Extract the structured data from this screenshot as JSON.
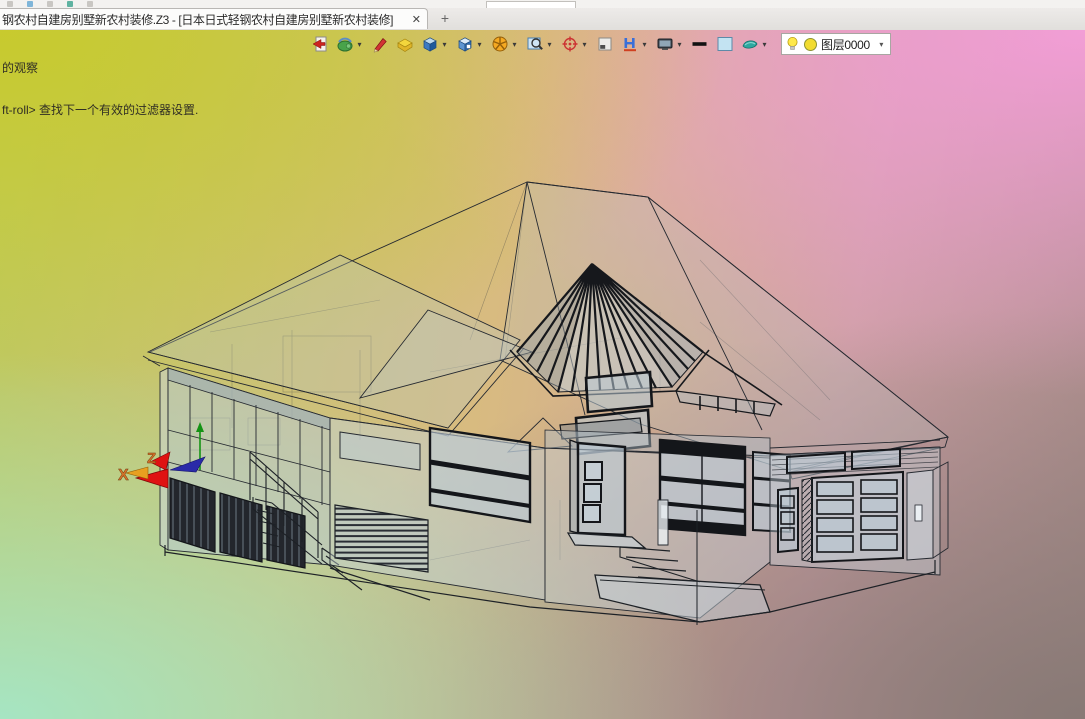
{
  "tab_bar": {
    "active_tab_title": "钢农村自建房别墅新农村装修.Z3 - [日本日式轻钢农村自建房别墅新农村装修]",
    "close_glyph": "✕",
    "new_tab_glyph": "+"
  },
  "prompt": {
    "line1": "的观察",
    "line2": "ft-roll> 查找下一个有效的过滤器设置."
  },
  "toolbar": {
    "dropdown_glyph": "▾",
    "icons": [
      {
        "name": "exit-icon",
        "dropdown": false
      },
      {
        "name": "shade-view-icon",
        "dropdown": true
      },
      {
        "name": "erase-icon",
        "dropdown": false
      },
      {
        "name": "unfold-box-icon",
        "dropdown": false
      },
      {
        "name": "solid-cube-icon",
        "dropdown": true
      },
      {
        "name": "view-cube-icon",
        "dropdown": true
      },
      {
        "name": "section-wheel-icon",
        "dropdown": true
      },
      {
        "name": "zoom-window-icon",
        "dropdown": true
      },
      {
        "name": "locate-target-icon",
        "dropdown": true
      },
      {
        "name": "viewport-layout-icon",
        "dropdown": false
      },
      {
        "name": "section-view-icon",
        "dropdown": true
      },
      {
        "name": "display-monitor-icon",
        "dropdown": true
      },
      {
        "name": "line-width-icon",
        "dropdown": false
      },
      {
        "name": "color-swatch-icon",
        "dropdown": false
      },
      {
        "name": "surface-display-icon",
        "dropdown": true
      }
    ],
    "layer_combo": {
      "visibility_icon": "bulb-icon",
      "color_icon": "layer-color-dot",
      "value": "图层0000",
      "arrow_glyph": "▾"
    }
  },
  "viewport": {
    "triad": {
      "x_label": "X",
      "z_label": "Z"
    }
  },
  "colors": {
    "bg_top_left": "#c8ca2c",
    "bg_top_right": "#f49ed8",
    "bg_bottom_left": "#a5e6c6",
    "bg_bottom_right": "#867874",
    "wireframe_stroke": "#262a31",
    "glass_fill": "#c5d2dd",
    "turret_stripe": "#16181c",
    "axis_label": "#d4722a"
  }
}
